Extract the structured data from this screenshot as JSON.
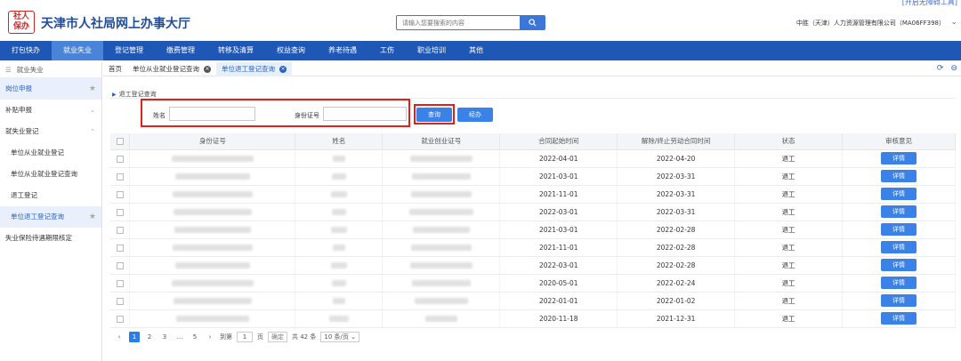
{
  "header": {
    "accessibility_link": "[开启无障碍工具]",
    "logo_text": [
      "社人",
      "保办"
    ],
    "site_title": "天津市人社局网上办事大厅",
    "search_placeholder": "请输入您要搜索的内容",
    "company": "中胜（天津）人力资源管理有限公司（MA06FF398）"
  },
  "nav": [
    "打包快办",
    "就业失业",
    "登记管理",
    "缴费管理",
    "转移及清算",
    "权益查询",
    "养老待遇",
    "工伤",
    "职业培训",
    "其他"
  ],
  "nav_active": 1,
  "sidebar": {
    "title": "就业失业",
    "items": [
      {
        "label": "岗位申报",
        "kind": "group-hi"
      },
      {
        "label": "补贴申报",
        "kind": "group"
      },
      {
        "label": "就失业登记",
        "kind": "group"
      },
      {
        "label": "单位从业就业登记",
        "kind": "sub"
      },
      {
        "label": "单位从业就业登记查询",
        "kind": "sub"
      },
      {
        "label": "退工登记",
        "kind": "sub"
      },
      {
        "label": "单位退工登记查询",
        "kind": "sub-hi"
      },
      {
        "label": "失业保险待遇期限核定",
        "kind": "plain"
      }
    ]
  },
  "tabs": [
    "首页",
    "单位从业就业登记查询",
    "单位退工登记查询"
  ],
  "filter": {
    "section_title": "退工登记查询",
    "name_label": "姓名",
    "id_label": "身份证号",
    "query_button": "查询",
    "handle_button": "经办"
  },
  "table": {
    "headers": [
      "身份证号",
      "姓名",
      "就业创业证号",
      "合同起始时间",
      "解除/终止劳动合同时间",
      "状态",
      "审核意见"
    ],
    "detail_label": "详情",
    "rows": [
      {
        "start": "2022-04-01",
        "end": "2022-04-20",
        "status": "退工"
      },
      {
        "start": "2021-03-01",
        "end": "2022-03-31",
        "status": "退工"
      },
      {
        "start": "2021-11-01",
        "end": "2022-03-31",
        "status": "退工"
      },
      {
        "start": "2022-03-01",
        "end": "2022-03-31",
        "status": "退工"
      },
      {
        "start": "2021-03-01",
        "end": "2022-02-28",
        "status": "退工"
      },
      {
        "start": "2021-11-01",
        "end": "2022-02-28",
        "status": "退工"
      },
      {
        "start": "2022-03-01",
        "end": "2022-02-28",
        "status": "退工"
      },
      {
        "start": "2020-05-01",
        "end": "2022-02-24",
        "status": "退工"
      },
      {
        "start": "2022-01-01",
        "end": "2022-01-02",
        "status": "退工"
      },
      {
        "start": "2020-11-18",
        "end": "2021-12-31",
        "status": "退工"
      }
    ]
  },
  "pagination": {
    "pages": [
      "1",
      "2",
      "3",
      "...",
      "5"
    ],
    "current": "1",
    "goto_label": "到第",
    "goto_value": "1",
    "page_label": "页",
    "confirm": "确定",
    "total": "共 42 条",
    "page_size": "10 条/页"
  },
  "colors": {
    "brand": "#1e57b5",
    "accent": "#3b82e8",
    "highlight": "#e0201c"
  }
}
